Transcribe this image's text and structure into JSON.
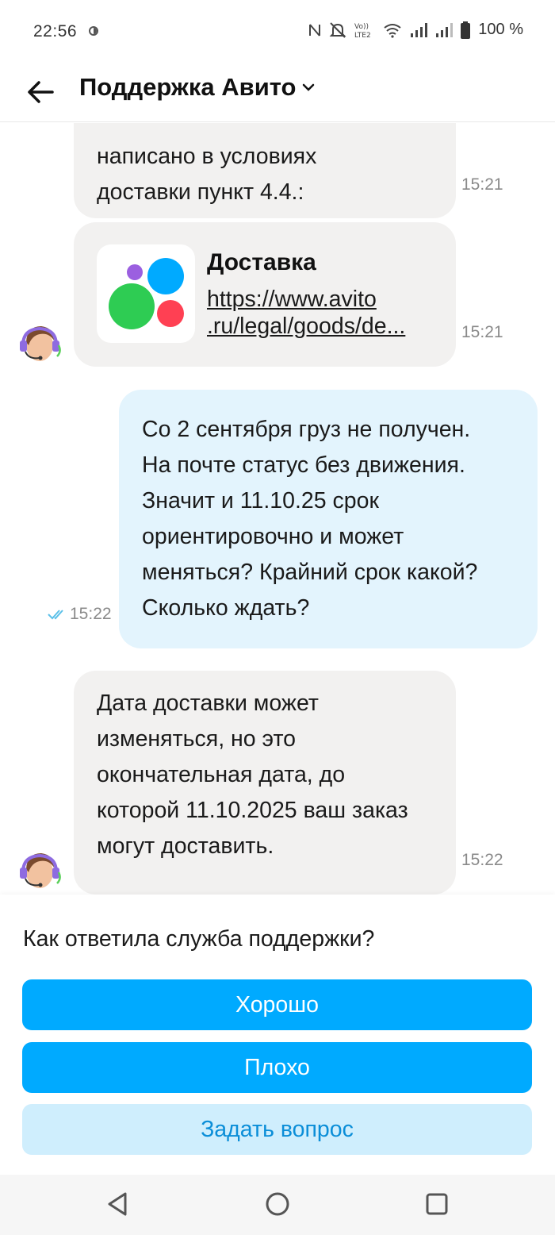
{
  "status_bar": {
    "time": "22:56",
    "battery": "100 %",
    "icons": [
      "nfc-icon",
      "mute-bell-icon",
      "volte-icon",
      "wifi-icon",
      "signal-icon",
      "signal-icon-2",
      "battery-icon"
    ]
  },
  "header": {
    "title": "Поддержка Авито"
  },
  "messages": [
    {
      "side": "in",
      "text": "написано в условиях\nдоставки пункт 4.4.:",
      "time": "15:21"
    },
    {
      "side": "in",
      "type": "link",
      "link_title": "Доставка",
      "link_url": "https://www.avito\n.ru/legal/goods/de...",
      "time": "15:21"
    },
    {
      "side": "out",
      "text": "Со 2 сентября груз не получен.\nНа почте статус без движения.\nЗначит и 11.10.25 срок\nориентировочно и может\nменяться? Крайний срок какой?\nСколько ждать?",
      "time": "15:22",
      "status": "read"
    },
    {
      "side": "in",
      "text": "Дата доставки может\nизменяться, но это\nокончательная дата, до\nкоторой 11.10.2025 ваш заказ\nмогут доставить.",
      "time": "15:22"
    }
  ],
  "rating": {
    "question": "Как ответила служба поддержки?",
    "good_label": "Хорошо",
    "bad_label": "Плохо",
    "ask_label": "Задать вопрос"
  },
  "colors": {
    "accent": "#00aaff",
    "secondary_button_bg": "#cfeefd",
    "secondary_button_text": "#0b8ed8",
    "incoming_bubble": "#f2f1f0",
    "outgoing_bubble": "#e3f4fd"
  }
}
